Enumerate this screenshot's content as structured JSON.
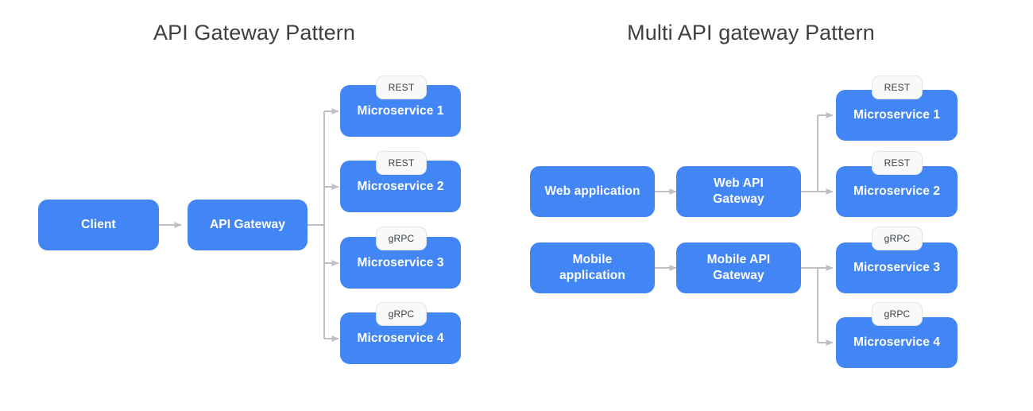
{
  "diagrams": [
    {
      "title": "API Gateway Pattern",
      "nodes": [
        {
          "id": "client",
          "label": "Client"
        },
        {
          "id": "api-gateway",
          "label": "API Gateway"
        },
        {
          "id": "ms1",
          "label": "Microservice 1",
          "badge": "REST"
        },
        {
          "id": "ms2",
          "label": "Microservice 2",
          "badge": "REST"
        },
        {
          "id": "ms3",
          "label": "Microservice 3",
          "badge": "gRPC"
        },
        {
          "id": "ms4",
          "label": "Microservice 4",
          "badge": "gRPC"
        }
      ]
    },
    {
      "title": "Multi API gateway Pattern",
      "nodes": [
        {
          "id": "web-app",
          "label": "Web application"
        },
        {
          "id": "mobile-app",
          "label": "Mobile\napplication"
        },
        {
          "id": "web-api-gateway",
          "label": "Web API\nGateway"
        },
        {
          "id": "mobile-api-gateway",
          "label": "Mobile API\nGateway"
        },
        {
          "id": "r-ms1",
          "label": "Microservice 1",
          "badge": "REST"
        },
        {
          "id": "r-ms2",
          "label": "Microservice 2",
          "badge": "REST"
        },
        {
          "id": "r-ms3",
          "label": "Microservice 3",
          "badge": "gRPC"
        },
        {
          "id": "r-ms4",
          "label": "Microservice 4",
          "badge": "gRPC"
        }
      ]
    }
  ],
  "colors": {
    "node_fill": "#4285f4",
    "node_text": "#ffffff",
    "badge_fill": "#f8f9fa",
    "badge_text": "#3c4043",
    "connector": "#bdc1c6",
    "title_text": "#3c4043",
    "background": "#ffffff"
  }
}
